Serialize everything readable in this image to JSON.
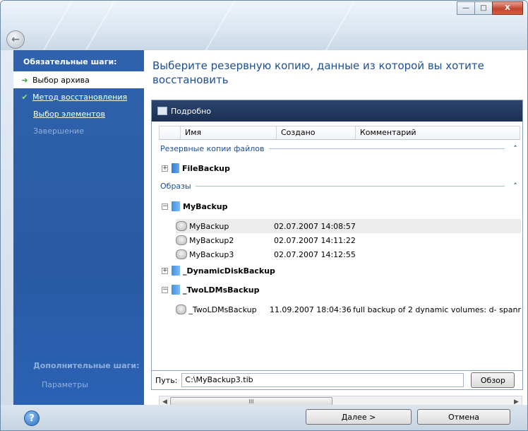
{
  "window": {
    "min": "—",
    "max": "□",
    "close": "X",
    "back_icon": "back-arrow-icon"
  },
  "sidebar": {
    "title": "Обязательные шаги:",
    "items": [
      {
        "label": "Выбор архива",
        "state": "active"
      },
      {
        "label": "Метод восстановления",
        "state": "done"
      },
      {
        "label": "Выбор элементов",
        "state": "link"
      },
      {
        "label": "Завершение",
        "state": "disabled"
      }
    ],
    "extra_title": "Дополнительные шаги:",
    "extra_items": [
      "Параметры"
    ]
  },
  "main": {
    "heading": "Выберите резервную копию, данные из которой вы хотите восстановить",
    "panel_title": "Подробно",
    "columns": [
      "Имя",
      "Создано",
      "Комментарий"
    ],
    "groups": [
      {
        "label": "Резервные копии файлов",
        "chev": "˄"
      },
      {
        "label": "Образы",
        "chev": "˄"
      }
    ],
    "file_backups": [
      {
        "name": "FileBackup",
        "toggle": "+"
      }
    ],
    "images": [
      {
        "name": "MyBackup",
        "toggle": "−",
        "children": [
          {
            "name": "MyBackup",
            "created": "02.07.2007 14:08:57",
            "comment": ""
          },
          {
            "name": "MyBackup2",
            "created": "02.07.2007 14:11:22",
            "comment": ""
          },
          {
            "name": "MyBackup3",
            "created": "02.07.2007 14:12:55",
            "comment": ""
          }
        ]
      },
      {
        "name": "_DynamicDiskBackup",
        "toggle": "+"
      },
      {
        "name": "_TwoLDMsBackup",
        "toggle": "−",
        "children": [
          {
            "name": "_TwoLDMsBackup",
            "created": "11.09.2007 18:04:36",
            "comment": "full backup of 2 dynamic volumes: d- spanr"
          }
        ]
      }
    ],
    "scroll_thumb": "III",
    "path_label": "Путь:",
    "path_value": "C:\\MyBackup3.tib",
    "browse": "Обзор"
  },
  "footer": {
    "help": "?",
    "next": "Далее >",
    "cancel": "Отмена"
  }
}
